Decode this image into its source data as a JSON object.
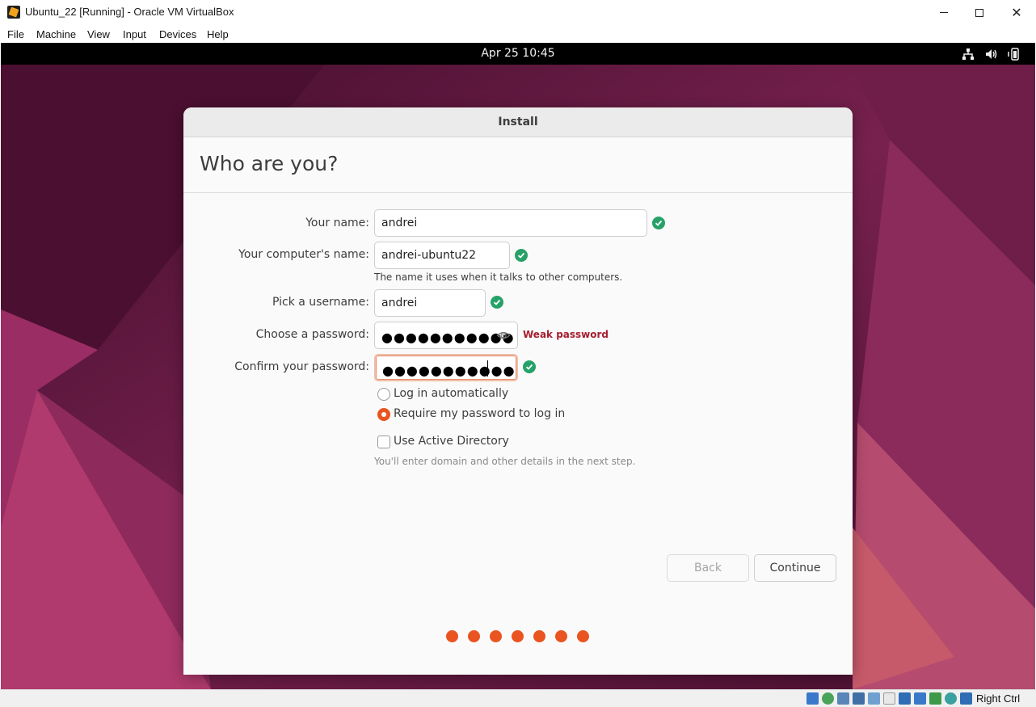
{
  "window": {
    "title": "Ubuntu_22 [Running] - Oracle VM VirtualBox"
  },
  "menu": [
    "File",
    "Machine",
    "View",
    "Input",
    "Devices",
    "Help"
  ],
  "topbar": {
    "clock": "Apr 25  10:45",
    "icons": [
      "network-icon",
      "volume-icon",
      "battery-icon"
    ]
  },
  "installer": {
    "window_title": "Install",
    "page_title": "Who are you?",
    "fields": {
      "name": {
        "label": "Your name:",
        "value": "andrei"
      },
      "computer": {
        "label": "Your computer's name:",
        "value": "andrei-ubuntu22",
        "hint": "The name it uses when it talks to other computers."
      },
      "username": {
        "label": "Pick a username:",
        "value": "andrei"
      },
      "password": {
        "label": "Choose a password:",
        "masked": "●●●●●●●●●●●",
        "strength": "Weak password"
      },
      "confirm": {
        "label": "Confirm your password:",
        "masked": "●●●●●●●●●●●"
      }
    },
    "login_options": {
      "auto": "Log in automatically",
      "require": "Require my password to log in",
      "selected": "require"
    },
    "active_directory": {
      "label": "Use Active Directory",
      "checked": false,
      "hint": "You'll enter domain and other details in the next step."
    },
    "buttons": {
      "back": "Back",
      "continue": "Continue"
    },
    "progress_steps": 7
  },
  "statusbar": {
    "host_key": "Right Ctrl"
  },
  "colors": {
    "accent": "#e95420",
    "success": "#26a269",
    "danger": "#a51d2d"
  }
}
